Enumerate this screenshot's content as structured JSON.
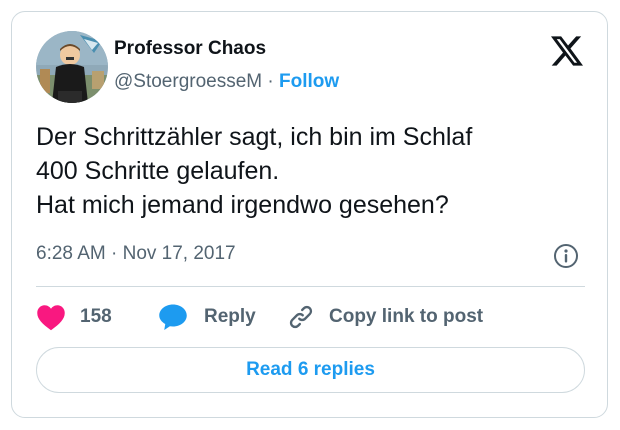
{
  "author": {
    "name": "Professor Chaos",
    "handle": "@StoergroesseM",
    "separator": " · ",
    "follow_label": "Follow"
  },
  "tweet": {
    "lines": [
      "Der Schrittzähler sagt, ich bin im Schlaf",
      "400 Schritte gelaufen.",
      "Hat mich jemand irgendwo gesehen?"
    ],
    "timestamp": "6:28 AM · Nov 17, 2017"
  },
  "actions": {
    "likes_count": "158",
    "reply_label": "Reply",
    "copy_label": "Copy link to post"
  },
  "read_replies_label": "Read 6 replies",
  "icons": {
    "logo": "x-logo-icon",
    "info": "info-icon",
    "like": "heart-icon",
    "reply": "speech-bubble-icon",
    "copy": "link-icon"
  },
  "colors": {
    "accent": "#1d9bf0",
    "heart": "#f91880",
    "secondary_text": "#536471",
    "border": "#cfd9de"
  }
}
